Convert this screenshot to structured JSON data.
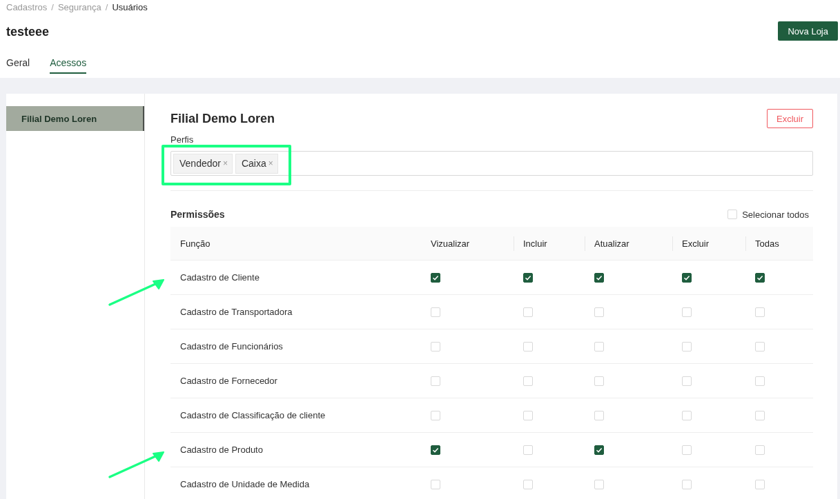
{
  "breadcrumb": [
    {
      "text": "Cadastros",
      "kind": "link"
    },
    {
      "text": "/",
      "kind": "separator"
    },
    {
      "text": "Segurança",
      "kind": "link"
    },
    {
      "text": "/",
      "kind": "separator"
    },
    {
      "text": "Usuários",
      "kind": "current"
    }
  ],
  "page_title": "testeee",
  "primary_button": "Nova Loja",
  "tabs": [
    {
      "label": "Geral",
      "selected": false
    },
    {
      "label": "Acessos",
      "selected": true
    }
  ],
  "sidebar": {
    "items": [
      {
        "label": "Filial Demo Loren",
        "selected": true
      }
    ]
  },
  "branch": {
    "title": "Filial Demo Loren",
    "delete_button": "Excluir",
    "profiles": {
      "label": "Perfis",
      "highlighted": true,
      "tags": [
        {
          "label": "Vendedor",
          "remove": "×"
        },
        {
          "label": "Caixa",
          "remove": "×"
        }
      ]
    },
    "permissions": {
      "title": "Permissões",
      "select_all": {
        "label": "Selecionar todos",
        "checked": false
      },
      "columns": [
        "Função",
        "Vizualizar",
        "Incluir",
        "Atualizar",
        "Excluir",
        "Todas"
      ],
      "rows": [
        {
          "name": "Cadastro de Cliente",
          "pointed": true,
          "checks": [
            true,
            true,
            true,
            true,
            true
          ]
        },
        {
          "name": "Cadastro de Transportadora",
          "pointed": false,
          "checks": [
            false,
            false,
            false,
            false,
            false
          ]
        },
        {
          "name": "Cadastro de Funcionários",
          "pointed": false,
          "checks": [
            false,
            false,
            false,
            false,
            false
          ]
        },
        {
          "name": "Cadastro de Fornecedor",
          "pointed": false,
          "checks": [
            false,
            false,
            false,
            false,
            false
          ]
        },
        {
          "name": "Cadastro de Classificação de cliente",
          "pointed": false,
          "checks": [
            false,
            false,
            false,
            false,
            false
          ]
        },
        {
          "name": "Cadastro de Produto",
          "pointed": true,
          "checks": [
            true,
            false,
            true,
            false,
            false
          ]
        },
        {
          "name": "Cadastro de Unidade de Medida",
          "pointed": false,
          "checks": [
            false,
            false,
            false,
            false,
            false
          ]
        }
      ]
    }
  }
}
